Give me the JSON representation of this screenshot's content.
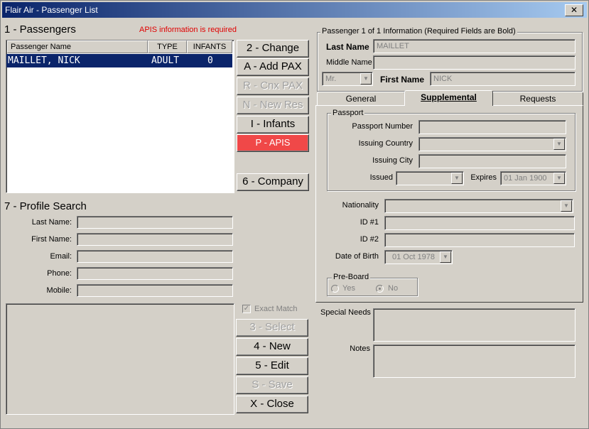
{
  "window": {
    "title": "Flair Air - Passenger List",
    "close_label": "✕"
  },
  "passengers": {
    "title": "1 - Passengers",
    "warning": "APIS information is required",
    "columns": [
      "Passenger Name",
      "TYPE",
      "INFANTS"
    ],
    "rows": [
      {
        "name": "MAILLET, NICK",
        "type": "ADULT",
        "infants": "0"
      }
    ]
  },
  "buttons": {
    "change": "2 - Change",
    "add_pax": "A - Add PAX",
    "cnx_pax": "R - Cnx PAX",
    "new_res": "N - New Res",
    "infants": "I - Infants",
    "apis": "P - APIS",
    "company": "6 - Company",
    "select": "3 - Select",
    "new": "4 - New",
    "edit": "5 - Edit",
    "save": "S - Save",
    "close": "X - Close"
  },
  "profile_search": {
    "title": "7 - Profile Search",
    "last_name_label": "Last Name:",
    "first_name_label": "First Name:",
    "email_label": "Email:",
    "phone_label": "Phone:",
    "mobile_label": "Mobile:",
    "exact_match_label": "Exact Match"
  },
  "passenger_info": {
    "legend": "Passenger 1 of 1 Information (Required Fields are Bold)",
    "last_name_label": "Last Name",
    "last_name_value": "MAILLET",
    "middle_name_label": "Middle Name",
    "middle_name_value": "",
    "title_value": "Mr.",
    "first_name_label": "First Name",
    "first_name_value": "NICK"
  },
  "tabs": [
    "General",
    "Supplemental",
    "Requests"
  ],
  "supplemental": {
    "passport_legend": "Passport",
    "passport_number_label": "Passport Number",
    "issuing_country_label": "Issuing Country",
    "issuing_city_label": "Issuing City",
    "issued_label": "Issued",
    "expires_label": "Expires",
    "expires_value": "01 Jan 1900",
    "nationality_label": "Nationality",
    "id1_label": "ID #1",
    "id2_label": "ID #2",
    "dob_label": "Date of Birth",
    "dob_value": "01 Oct 1978",
    "preboard_legend": "Pre-Board",
    "yes_label": "Yes",
    "no_label": "No"
  },
  "special_needs_label": "Special Needs",
  "notes_label": "Notes"
}
